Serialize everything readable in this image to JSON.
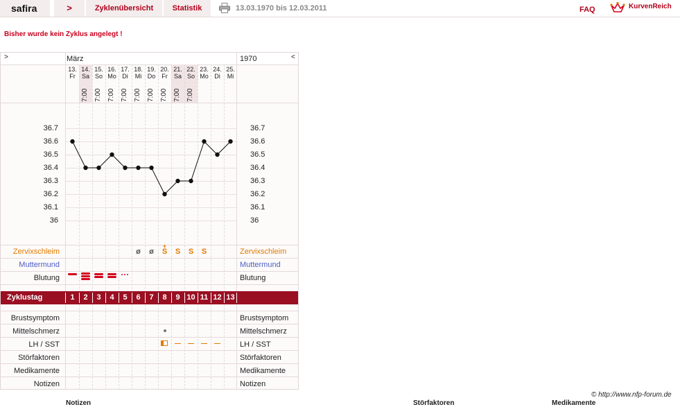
{
  "topbar": {
    "brand": "safira",
    "arrow": ">",
    "tab_zyklen": "Zyklenübersicht",
    "tab_statistik": "Statistik",
    "date_range": "13.03.1970 bis 12.03.2011",
    "faq": "FAQ",
    "logo": "KurvenReich"
  },
  "notice": "Bisher wurde kein Zyklus angelegt !",
  "chart": {
    "nav_left": ">",
    "nav_right": "<",
    "month": "März",
    "year": "1970",
    "days": [
      {
        "num": "13.",
        "dow": "Fr",
        "time": "",
        "weekend": false
      },
      {
        "num": "14.",
        "dow": "Sa",
        "time": "7:00",
        "weekend": true
      },
      {
        "num": "15.",
        "dow": "So",
        "time": "7:00",
        "weekend": false
      },
      {
        "num": "16.",
        "dow": "Mo",
        "time": "7:00",
        "weekend": false
      },
      {
        "num": "17.",
        "dow": "Di",
        "time": "7:00",
        "weekend": false
      },
      {
        "num": "18.",
        "dow": "Mi",
        "time": "7:00",
        "weekend": false
      },
      {
        "num": "19.",
        "dow": "Do",
        "time": "7:00",
        "weekend": false
      },
      {
        "num": "20.",
        "dow": "Fr",
        "time": "7:00",
        "weekend": false
      },
      {
        "num": "21.",
        "dow": "Sa",
        "time": "7:00",
        "weekend": true
      },
      {
        "num": "22.",
        "dow": "So",
        "time": "7:00",
        "weekend": true
      },
      {
        "num": "23.",
        "dow": "Mo",
        "time": "",
        "weekend": false
      },
      {
        "num": "24.",
        "dow": "Di",
        "time": "",
        "weekend": false
      },
      {
        "num": "25.",
        "dow": "Mi",
        "time": "",
        "weekend": false
      }
    ],
    "temps": [
      36.6,
      36.4,
      36.4,
      36.5,
      36.4,
      36.4,
      36.4,
      36.2,
      36.3,
      36.3,
      36.6,
      36.5,
      36.6
    ],
    "y_ticks": [
      "36.7",
      "36.6",
      "36.5",
      "36.4",
      "36.3",
      "36.2",
      "36.1",
      "36"
    ],
    "y_min": 36.0,
    "y_max": 36.7,
    "rows": {
      "zervix": "Zervixschleim",
      "mutter": "Muttermund",
      "blutung": "Blutung",
      "zyklustag": "Zyklustag",
      "brust": "Brustsymptom",
      "mittel": "Mittelschmerz",
      "lh": "LH / SST",
      "stoer": "Störfaktoren",
      "medik": "Medikamente",
      "notizen": "Notizen"
    },
    "zervix_values": [
      "",
      "",
      "",
      "",
      "",
      "ø",
      "ø",
      "S",
      "S",
      "S",
      "S",
      "",
      ""
    ],
    "zervix_plus": [
      "",
      "",
      "",
      "",
      "",
      "",
      "",
      "+",
      "",
      "",
      "",
      "",
      ""
    ],
    "bleeding": [
      "heavy",
      "very-heavy",
      "heavy",
      "heavy",
      "spotting",
      "",
      "",
      "",
      "",
      "",
      "",
      "",
      ""
    ],
    "cycle_days": [
      "1",
      "2",
      "3",
      "4",
      "5",
      "6",
      "7",
      "8",
      "9",
      "10",
      "11",
      "12",
      "13"
    ],
    "mittelschmerz": [
      false,
      false,
      false,
      false,
      false,
      false,
      false,
      true,
      false,
      false,
      false,
      false,
      false
    ],
    "lh": [
      "",
      "",
      "",
      "",
      "",
      "",
      "",
      "box",
      "dash",
      "dash",
      "dash",
      "dash",
      ""
    ],
    "colors": {
      "zervix": "#e07b00",
      "mutter": "#4b5fc4",
      "accent": "#9a0f22",
      "blood": "#d4001c"
    }
  },
  "footer": "© http://www.nfp-forum.de",
  "bottom": {
    "notizen": "Notizen",
    "stoer": "Störfaktoren",
    "medik": "Medikamente"
  }
}
